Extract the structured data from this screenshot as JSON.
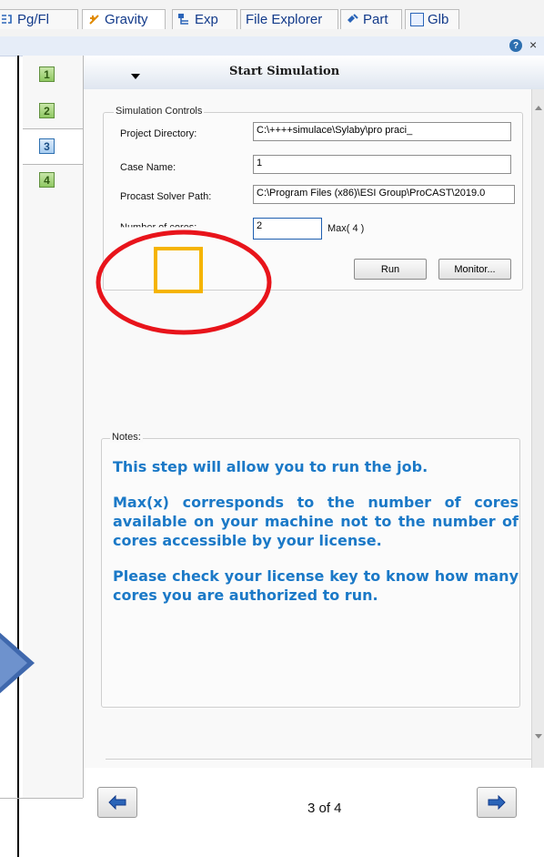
{
  "tabs": [
    {
      "icon": "pg-fl-icon",
      "label": "Pg/Fl"
    },
    {
      "icon": "gravity-icon",
      "label": "Gravity"
    },
    {
      "icon": "exp-icon",
      "label": "Exp"
    },
    {
      "icon": "",
      "label": "File Explorer"
    },
    {
      "icon": "part-icon",
      "label": "Part"
    },
    {
      "icon": "glb-icon",
      "label": "Glb"
    }
  ],
  "toolbar": {
    "help_glyph": "?",
    "close_glyph": "×"
  },
  "steps": [
    "1",
    "2",
    "3",
    "4"
  ],
  "current_step": 3,
  "header": {
    "title": "Start Simulation"
  },
  "simulation_controls": {
    "legend": "Simulation Controls",
    "project_directory": {
      "label": "Project Directory:",
      "value": "C:\\++++simulace\\Sylaby\\pro praci_"
    },
    "case_name": {
      "label": "Case Name:",
      "value": "1"
    },
    "solver_path": {
      "label": "Procast Solver Path:",
      "value": "C:\\Program Files (x86)\\ESI Group\\ProCAST\\2019.0"
    },
    "cores": {
      "label": "Number of cores:",
      "value": "2",
      "max_label": "Max( 4 )"
    },
    "run_label": "Run",
    "monitor_label": "Monitor..."
  },
  "notes": {
    "legend": "Notes:",
    "paragraphs": [
      "This step will allow you to run the job.",
      "Max(x) corresponds to the number of cores available on your machine not to the number of cores accessible by your license.",
      "Please check your license key to know how many cores you are authorized to run."
    ]
  },
  "pagination": {
    "text": "3 of 4"
  },
  "colors": {
    "notes_text": "#1b79c7",
    "annotation_ellipse": "#e8141b",
    "annotation_square": "#f5b400",
    "big_arrow": "#3f68ad"
  }
}
